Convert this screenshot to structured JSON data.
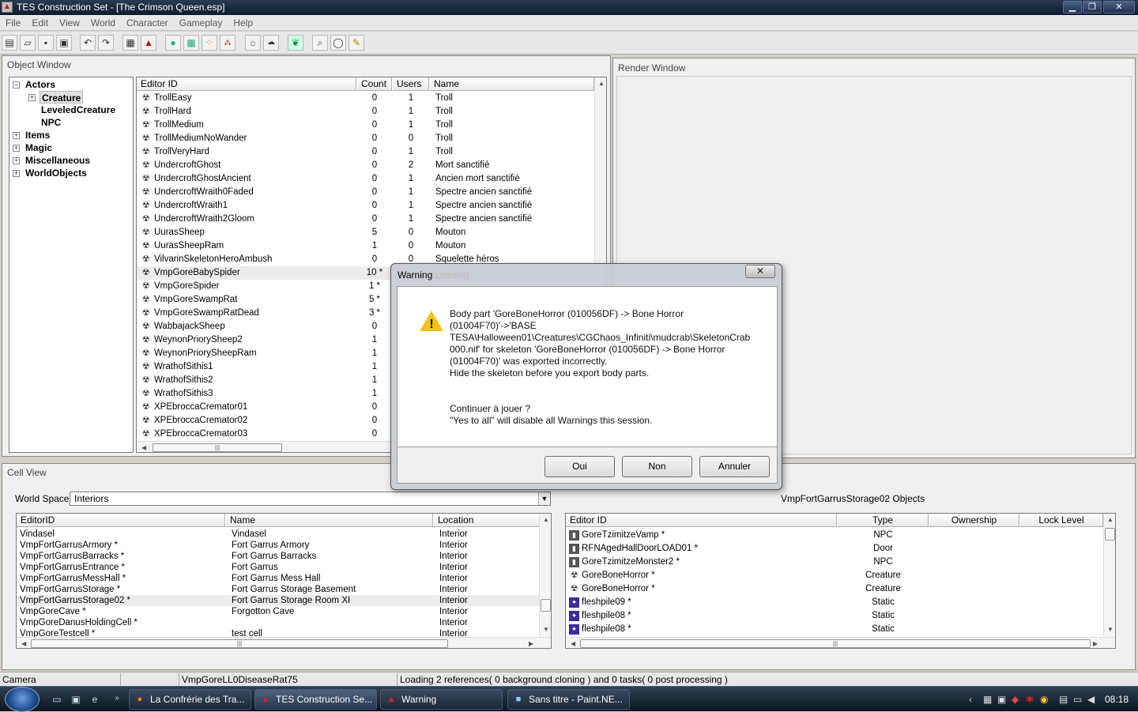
{
  "window": {
    "title": "TES Construction Set - [The Crimson Queen.esp]"
  },
  "menu": [
    "File",
    "Edit",
    "View",
    "World",
    "Character",
    "Gameplay",
    "Help"
  ],
  "toolbar_icons": [
    "new-icon",
    "open-icon",
    "save-icon",
    "save-as-icon",
    "undo-icon",
    "redo-icon",
    "grid-icon",
    "snap-icon",
    "landscape-icon",
    "map-icon",
    "path-grid-icon",
    "havok-icon",
    "light-icon",
    "sky-icon",
    "leaf-icon",
    "search-icon",
    "lasso-icon",
    "pencil-icon"
  ],
  "object_window": {
    "title": "Object Window",
    "tree": [
      {
        "label": "Actors",
        "level": 0,
        "expander": "−"
      },
      {
        "label": "Creature",
        "level": 1,
        "expander": "+",
        "selected": true
      },
      {
        "label": "LeveledCreature",
        "level": 1,
        "expander": ""
      },
      {
        "label": "NPC",
        "level": 1,
        "expander": ""
      },
      {
        "label": "Items",
        "level": 0,
        "expander": "+"
      },
      {
        "label": "Magic",
        "level": 0,
        "expander": "+"
      },
      {
        "label": "Miscellaneous",
        "level": 0,
        "expander": "+"
      },
      {
        "label": "WorldObjects",
        "level": 0,
        "expander": "+"
      }
    ],
    "columns": [
      "Editor ID",
      "Count",
      "Users",
      "Name"
    ],
    "rows": [
      {
        "id": "TrollEasy",
        "count": "0",
        "users": "1",
        "name": "Troll"
      },
      {
        "id": "TrollHard",
        "count": "0",
        "users": "1",
        "name": "Troll"
      },
      {
        "id": "TrollMedium",
        "count": "0",
        "users": "1",
        "name": "Troll"
      },
      {
        "id": "TrollMediumNoWander",
        "count": "0",
        "users": "0",
        "name": "Troll"
      },
      {
        "id": "TrollVeryHard",
        "count": "0",
        "users": "1",
        "name": "Troll"
      },
      {
        "id": "UndercroftGhost",
        "count": "0",
        "users": "2",
        "name": "Mort sanctifié"
      },
      {
        "id": "UndercroftGhostAncient",
        "count": "0",
        "users": "1",
        "name": "Ancien mort sanctifié"
      },
      {
        "id": "UndercroftWraith0Faded",
        "count": "0",
        "users": "1",
        "name": "Spectre ancien sanctifié"
      },
      {
        "id": "UndercroftWraith1",
        "count": "0",
        "users": "1",
        "name": "Spectre ancien sanctifié"
      },
      {
        "id": "UndercroftWraith2Gloom",
        "count": "0",
        "users": "1",
        "name": "Spectre ancien sanctifié"
      },
      {
        "id": "UurasSheep",
        "count": "5",
        "users": "0",
        "name": "Mouton"
      },
      {
        "id": "UurasSheepRam",
        "count": "1",
        "users": "0",
        "name": "Mouton"
      },
      {
        "id": "VilvarinSkeletonHeroAmbush",
        "count": "0",
        "users": "0",
        "name": "Squelette héros"
      },
      {
        "id": "VmpGoreBabySpider",
        "count": "10 *",
        "users": "",
        "name": "",
        "hl": true
      },
      {
        "id": "VmpGoreSpider",
        "count": "1 *",
        "users": "",
        "name": ""
      },
      {
        "id": "VmpGoreSwampRat",
        "count": "5 *",
        "users": "",
        "name": ""
      },
      {
        "id": "VmpGoreSwampRatDead",
        "count": "3 *",
        "users": "",
        "name": ""
      },
      {
        "id": "WabbajackSheep",
        "count": "0",
        "users": "",
        "name": ""
      },
      {
        "id": "WeynonPriorySheep2",
        "count": "1",
        "users": "",
        "name": ""
      },
      {
        "id": "WeynonPriorySheepRam",
        "count": "1",
        "users": "",
        "name": ""
      },
      {
        "id": "WrathofSithis1",
        "count": "1",
        "users": "",
        "name": ""
      },
      {
        "id": "WrathofSithis2",
        "count": "1",
        "users": "",
        "name": ""
      },
      {
        "id": "WrathofSithis3",
        "count": "1",
        "users": "",
        "name": ""
      },
      {
        "id": "XPEbroccaCremator01",
        "count": "0",
        "users": "",
        "name": ""
      },
      {
        "id": "XPEbroccaCremator02",
        "count": "0",
        "users": "",
        "name": ""
      },
      {
        "id": "XPEbroccaCremator03",
        "count": "0",
        "users": "",
        "name": ""
      }
    ]
  },
  "render_window": {
    "title": "Render Window"
  },
  "cell_view": {
    "title": "Cell View",
    "world_space_label": "World Space",
    "world_space_value": "Interiors",
    "objects_title": "VmpFortGarrusStorage02 Objects",
    "cell_columns": [
      "EditorID",
      "Name",
      "Location"
    ],
    "cells": [
      {
        "id": "Vindasel",
        "name": "Vindasel",
        "loc": "Interior"
      },
      {
        "id": "VmpFortGarrusArmory *",
        "name": "Fort Garrus Armory",
        "loc": "Interior"
      },
      {
        "id": "VmpFortGarrusBarracks *",
        "name": "Fort Garrus Barracks",
        "loc": "Interior"
      },
      {
        "id": "VmpFortGarrusEntrance *",
        "name": "Fort Garrus",
        "loc": "Interior"
      },
      {
        "id": "VmpFortGarrusMessHall *",
        "name": "Fort Garrus Mess Hall",
        "loc": "Interior"
      },
      {
        "id": "VmpFortGarrusStorage *",
        "name": "Fort Garrus Storage Basement",
        "loc": "Interior"
      },
      {
        "id": "VmpFortGarrusStorage02 *",
        "name": "Fort Garrus Storage Room XI",
        "loc": "Interior",
        "hl": true
      },
      {
        "id": "VmpGoreCave *",
        "name": "Forgotton Cave",
        "loc": "Interior"
      },
      {
        "id": "VmpGoreDanusHoldingCell *",
        "name": "",
        "loc": "Interior"
      },
      {
        "id": "VmpGoreTestcell *",
        "name": "test cell",
        "loc": "Interior"
      }
    ],
    "obj_columns": [
      "Editor ID",
      "Type",
      "Ownership",
      "Lock Level"
    ],
    "objects": [
      {
        "id": "GoreTzimitzeVamp *",
        "type": "NPC",
        "icon": "npc"
      },
      {
        "id": "RFNAgedHallDoorLOAD01 *",
        "type": "Door",
        "icon": "npc"
      },
      {
        "id": "GoreTzimitzeMonster2 *",
        "type": "NPC",
        "icon": "npc"
      },
      {
        "id": "GoreBoneHorror *",
        "type": "Creature",
        "icon": "creature"
      },
      {
        "id": "GoreBoneHorror *",
        "type": "Creature",
        "icon": "creature"
      },
      {
        "id": "fleshpile09 *",
        "type": "Static",
        "icon": "static"
      },
      {
        "id": "fleshpile08 *",
        "type": "Static",
        "icon": "static"
      },
      {
        "id": "fleshpile08 *",
        "type": "Static",
        "icon": "static"
      }
    ]
  },
  "dialog": {
    "title": "Warning",
    "title_ghost": "Loading",
    "close": "✕",
    "message": "Body part 'GoreBoneHorror (010056DF) -> Bone Horror\n(01004F70)'->'BASE\nTESA\\Halloween01\\Creatures\\CGChaos_Infiniti\\mudcrab\\SkeletonCrab\n000.nif' for skeleton 'GoreBoneHorror (010056DF) -> Bone Horror\n(01004F70)' was exported incorrectly.\nHide the skeleton before you export body parts.\n\n\nContinuer à jouer ?\n\"Yes to all\" will disable all Warnings this session.",
    "buttons": [
      "Oui",
      "Non",
      "Annuler"
    ]
  },
  "status": {
    "mode": "Camera",
    "seg2": "",
    "ref": "VmpGoreLL0DiseaseRat75",
    "message": "Loading 2 references( 0 background cloning ) and 0 tasks( 0 post processing )"
  },
  "taskbar": {
    "tasks": [
      {
        "label": "La Confrérie des Tra...",
        "icon": "firefox-icon",
        "glyph": "●"
      },
      {
        "label": "TES Construction Se...",
        "icon": "tescs-icon",
        "glyph": "▲",
        "active": true
      },
      {
        "label": "Warning",
        "icon": "warning-task-icon",
        "glyph": "▲"
      },
      {
        "label": "Sans titre - Paint.NE...",
        "icon": "paint-icon",
        "glyph": "■"
      }
    ],
    "clock": "08:18"
  }
}
